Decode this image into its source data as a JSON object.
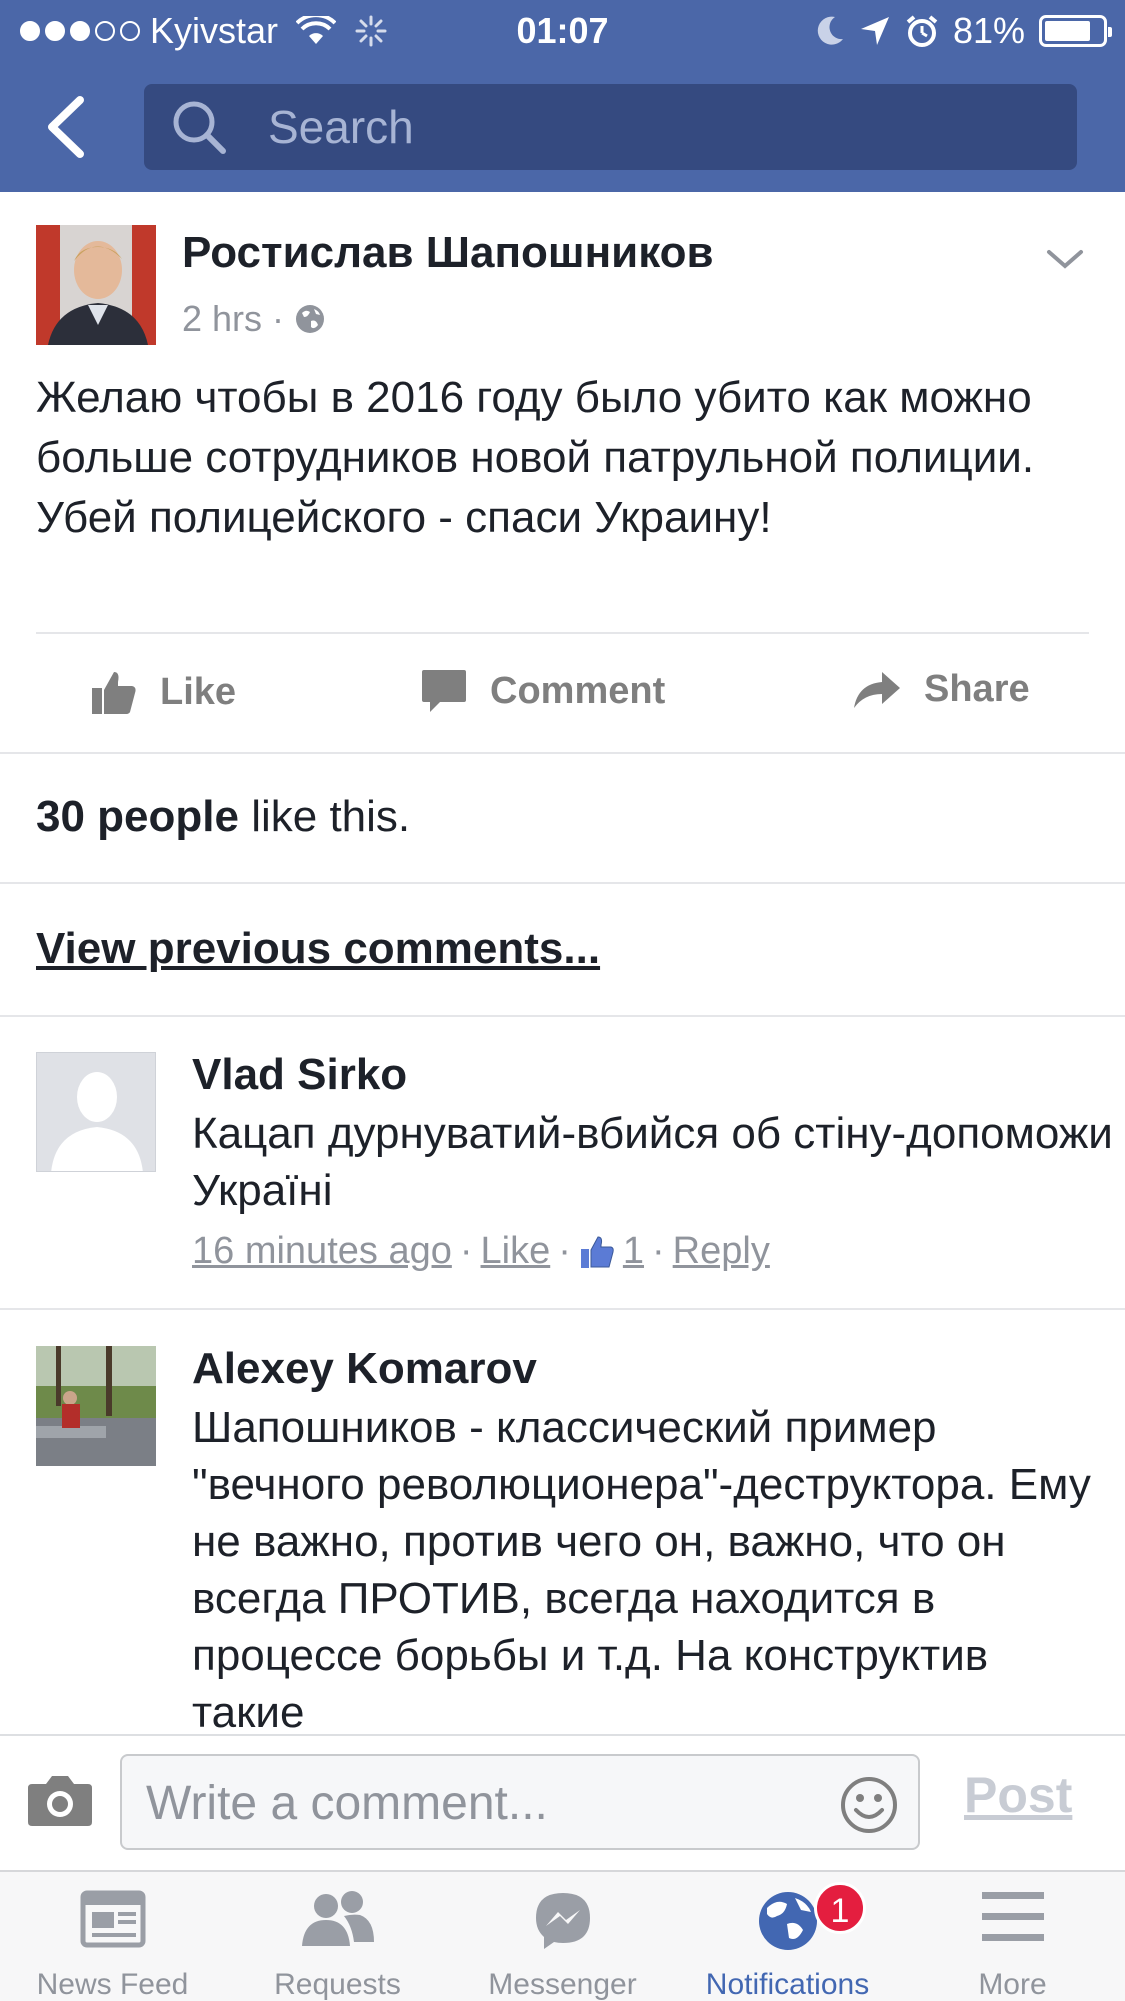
{
  "status_bar": {
    "carrier": "Kyivstar",
    "signal_bars_filled": 3,
    "signal_bars_total": 5,
    "time": "01:07",
    "battery": "81%",
    "battery_level": 0.81
  },
  "search": {
    "placeholder": "Search"
  },
  "post": {
    "author": "Ростислав Шапошников",
    "time": "2 hrs",
    "separator": "·",
    "text": "Желаю чтобы в 2016 году было убито как можно больше сотрудников новой патрульной полиции. Убей полицейского - спаси Украину!"
  },
  "actions": {
    "like": "Like",
    "comment": "Comment",
    "share": "Share"
  },
  "likes": {
    "count_text": "30 people",
    "suffix": " like this."
  },
  "view_previous": "View previous comments...",
  "comments": [
    {
      "name": "Vlad Sirko",
      "text": "Кацап дурнуватий-вбийся об стіну-допоможи Україні",
      "time": "16 minutes ago",
      "like": "Like",
      "like_count": "1",
      "reply": "Reply",
      "sep": "·"
    },
    {
      "name": "Alexey Komarov",
      "text": "Шапошников - классический пример \"вечного революционера\"-деструктора. Ему не важно, против чего он, важно, что он всегда ПРОТИВ, всегда находится в процессе борьбы и т.д. На конструктив такие"
    }
  ],
  "composer": {
    "placeholder": "Write a comment...",
    "post": "Post"
  },
  "tabs": [
    {
      "label": "News Feed",
      "icon": "news-feed-icon"
    },
    {
      "label": "Requests",
      "icon": "friend-requests-icon"
    },
    {
      "label": "Messenger",
      "icon": "messenger-icon"
    },
    {
      "label": "Notifications",
      "icon": "globe-icon",
      "active": true
    },
    {
      "label": "More",
      "icon": "menu-icon"
    }
  ],
  "notification_badge": "1",
  "colors": {
    "header": "#4b67a8",
    "search_bg": "#354a80",
    "active_tab": "#4267b2",
    "badge": "#e41e3f"
  }
}
